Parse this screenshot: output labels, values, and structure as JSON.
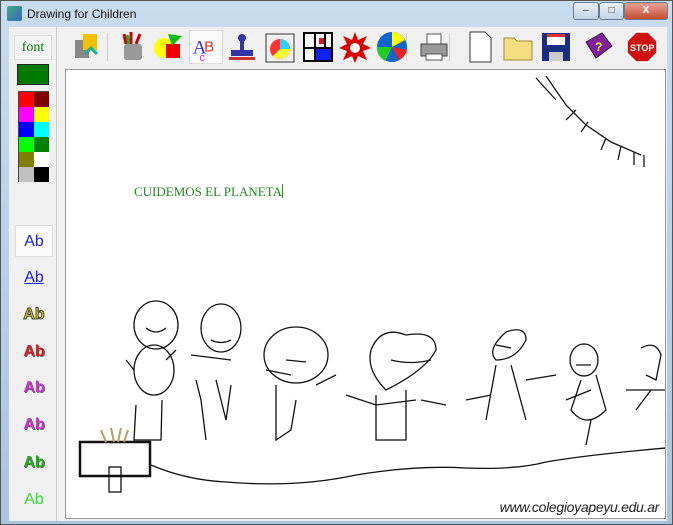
{
  "window": {
    "title": "Drawing for Children",
    "minimize": "–",
    "maximize": "□",
    "close": "X"
  },
  "left_panel": {
    "font_label": "font",
    "current_color": "#007a00",
    "palette": [
      "#ff0000",
      "#800000",
      "#ff00ff",
      "#ffff00",
      "#0000ff",
      "#00ffff",
      "#00ff00",
      "#008000",
      "#808000",
      "#ffffff",
      "#c0c0c0",
      "#000000"
    ],
    "text_styles": [
      {
        "label": "Ab",
        "color": "#2222cc",
        "style": "plain",
        "selected": true
      },
      {
        "label": "Ab",
        "color": "#2222cc",
        "style": "underline"
      },
      {
        "label": "Ab",
        "color": "#d8d800",
        "style": "outline"
      },
      {
        "label": "Ab",
        "color": "#cc2222",
        "style": "shadow"
      },
      {
        "label": "Ab",
        "color": "#cc33cc",
        "style": "shadow"
      },
      {
        "label": "Ab",
        "color": "#cc33cc",
        "style": "shadow-light"
      },
      {
        "label": "Ab",
        "color": "#22aa22",
        "style": "shadow-dark"
      },
      {
        "label": "Ab",
        "color": "#33dd33",
        "style": "plain"
      }
    ]
  },
  "toolbar": {
    "tools": [
      {
        "name": "clear-recycle",
        "icon": "recycle-icon"
      },
      {
        "name": "pencils",
        "icon": "pencil-cup-icon"
      },
      {
        "name": "shapes",
        "icon": "shapes-icon"
      },
      {
        "name": "text",
        "icon": "text-ab-icon",
        "selected": true
      },
      {
        "name": "stamp",
        "icon": "stamp-icon"
      },
      {
        "name": "picture",
        "icon": "picture-icon"
      },
      {
        "name": "mondrian",
        "icon": "mondrian-icon"
      },
      {
        "name": "explosion",
        "icon": "explosion-icon"
      },
      {
        "name": "spiral",
        "icon": "spiral-icon"
      },
      {
        "name": "print",
        "icon": "printer-icon"
      },
      {
        "name": "new",
        "icon": "new-page-icon"
      },
      {
        "name": "open",
        "icon": "folder-icon"
      },
      {
        "name": "save",
        "icon": "floppy-icon"
      },
      {
        "name": "help",
        "icon": "help-book-icon"
      },
      {
        "name": "exit",
        "icon": "stop-icon"
      }
    ]
  },
  "canvas": {
    "text": "CUIDEMOS EL PLANETA",
    "watermark": "www.colegioyapeyu.edu.ar"
  }
}
